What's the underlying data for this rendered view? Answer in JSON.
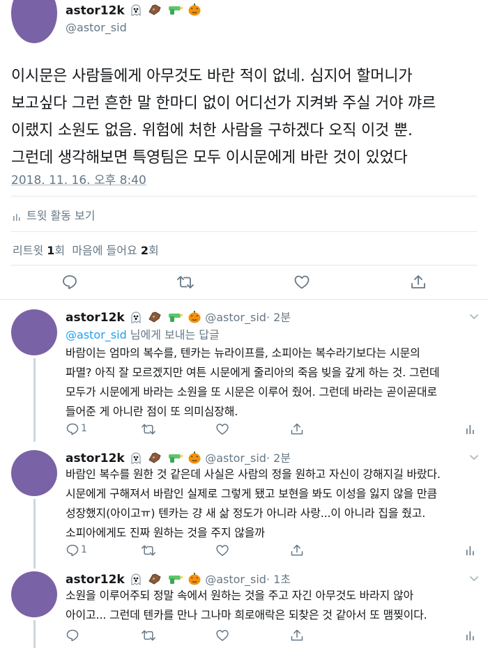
{
  "tweet": {
    "name": "astor12k",
    "handle": "@astor_sid",
    "text_lines": [
      "이시문은 사람들에게 아무것도 바란 적이 없네. 심지어 할머니가",
      "보고싶다 그런 흔한 말 한마디 없이 어디선가 지켜봐 주실 거야 꺄르",
      "이랬지 소원도 없음. 위험에 처한 사람을 구하겠다 오직 이것 뿐.",
      "그런데 생각해보면 특영팀은 모두 이시문에게 바란 것이 있었다"
    ],
    "timestamp": "2018. 11. 16. 오후 8:40",
    "activity_label": "트윗 활동 보기",
    "retweet_label": "리트윗",
    "retweet_count": "1",
    "retweet_unit": "회",
    "like_label": "마음에 들어요",
    "like_count": "2",
    "like_unit": "회"
  },
  "replies": [
    {
      "name": "astor12k",
      "handle": "@astor_sid",
      "time": "· 2분",
      "reply_to_handle": "@astor_sid",
      "reply_to_suffix": " 님에게 보내는 답글",
      "text_lines": [
        "바람이는 엄마의 복수를, 텐카는 뉴라이프를, 소피아는 복수라기보다는 시문의",
        "파멸? 아직 잘 모르겠지만 여튼 시문에게 줄리아의 죽음 빚을 갚게 하는 것. 그런데",
        "모두가 시문에게 바라는 소원을 또 시문은 이루어 줬어. 그런데 바라는 곧이곧대로",
        "들어준 게 아니란 점이 또 의미심장해."
      ],
      "reply_count": "1"
    },
    {
      "name": "astor12k",
      "handle": "@astor_sid",
      "time": "· 2분",
      "text_lines": [
        "바람인 복수를 원한 것 같은데 사실은 사람의 정을 원하고 자신이 강해지길 바랐다.",
        "시문에게 구해져서 바람인 실제로 그렇게 됐고 보현을 봐도 이성을 잃지 않을 만큼",
        "성장했지(아이고ㅠ) 텐카는 걍 새 삶 정도가 아니라 사랑...이 아니라 집을 줬고.",
        "소피아에게도 진짜 원하는 것을 주지 않을까"
      ],
      "reply_count": "1"
    },
    {
      "name": "astor12k",
      "handle": "@astor_sid",
      "time": "· 1초",
      "text_lines": [
        "소원을 이루어주되 정말 속에서 원하는 것을 주고 자긴 아무것도 바라지 않아",
        "아이고... 그런데 텐카를 만나 그나마 희로애락은 되찾은 것 같아서 또 맴찢이다."
      ],
      "reply_count": ""
    }
  ],
  "icons": [
    "ghost-emoji",
    "coffin-emoji",
    "water-pistol-emoji",
    "jack-o-lantern-emoji",
    "reply-icon",
    "retweet-icon",
    "like-icon",
    "share-icon",
    "analytics-icon",
    "chevron-down-icon"
  ],
  "colors": {
    "avatar": "#7a62a6",
    "link": "#1da1f2",
    "secondary": "#657786",
    "border": "#e1e8ed"
  }
}
